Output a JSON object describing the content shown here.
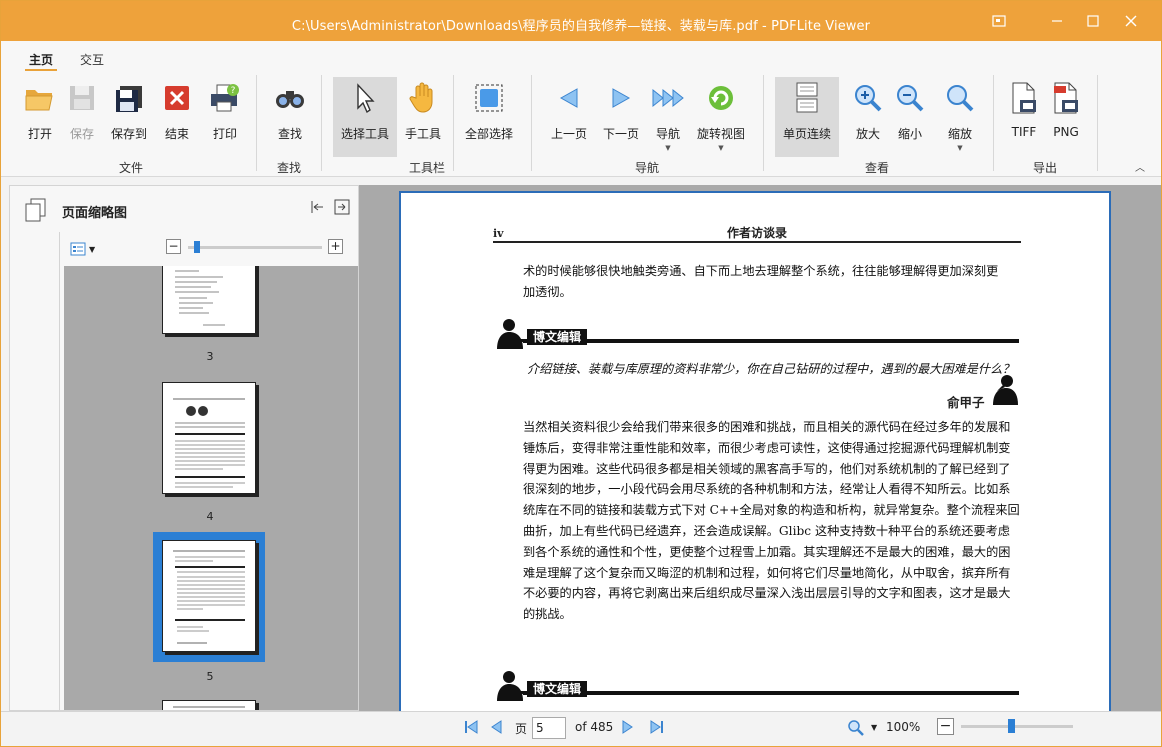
{
  "window": {
    "title": "C:\\Users\\Administrator\\Downloads\\程序员的自我修养—链接、装载与库.pdf - PDFLite Viewer"
  },
  "ribbon_tabs": [
    {
      "label": "主页",
      "active": true
    },
    {
      "label": "交互",
      "active": false
    }
  ],
  "ribbon": {
    "groups": {
      "file": "文件",
      "find": "查找",
      "toolbar": "工具栏",
      "nav": "导航",
      "view": "查看",
      "export": "导出"
    },
    "buttons": {
      "open": "打开",
      "save": "保存",
      "save_as": "保存到",
      "close": "结束",
      "print": "打印",
      "find": "查找",
      "select_tool": "选择工具",
      "hand_tool": "手工具",
      "select_all": "全部选择",
      "prev_page": "上一页",
      "next_page": "下一页",
      "navigate": "导航",
      "rotate_view": "旋转视图",
      "single_continuous": "单页连续",
      "zoom_in": "放大",
      "zoom_out": "缩小",
      "zoom": "缩放",
      "tiff": "TIFF",
      "png": "PNG"
    }
  },
  "sidepanel": {
    "title": "页面缩略图",
    "thumb_zoom": 0.05,
    "thumbnails": [
      {
        "number": "3"
      },
      {
        "number": "4"
      },
      {
        "number": "5",
        "selected": true
      }
    ]
  },
  "document_page": {
    "header_left": "iv",
    "header_center": "作者访谈录",
    "intro_lines": [
      "术的时候能够很快地触类旁通、自下而上地去理解整个系统，往往能够理解得更加深刻更",
      "加透彻。"
    ],
    "section_tag": "博文编辑",
    "question": "介绍链接、装载与库原理的资料非常少，你在自己钻研的过程中，遇到的最大困难是什么？",
    "author": "俞甲子",
    "answer_lines": [
      "当然相关资料很少会给我们带来很多的困难和挑战，而且相关的源代码在经过多年的发展和",
      "锤炼后，变得非常注重性能和效率，而很少考虑可读性，这使得通过挖掘源代码理解机制变",
      "得更为困难。这些代码很多都是相关领域的黑客高手写的，他们对系统机制的了解已经到了",
      "很深刻的地步，一小段代码会用尽系统的各种机制和方法，经常让人看得不知所云。比如系",
      "统库在不同的链接和装载方式下对 C++全局对象的构造和析构，就异常复杂。整个流程来回",
      "曲折，加上有些代码已经遗弃，还会造成误解。Glibc 这种支持数十种平台的系统还要考虑",
      "到各个系统的通性和个性，更使整个过程雪上加霜。其实理解还不是最大的困难，最大的困",
      "难是理解了这个复杂而又晦涩的机制和过程，如何将它们尽量地简化，从中取舍，摈弃所有",
      "不必要的内容，再将它剥离出来后组织成尽量深入浅出层层引导的文字和图表，这才是最大",
      "的挑战。"
    ],
    "section_tag_2": "博文编辑"
  },
  "statusbar": {
    "page_label": "页",
    "page_value": "5",
    "page_total": "of 485",
    "zoom": "100%",
    "zoom_slider": 0.45
  },
  "colors": {
    "accent": "#eea23b",
    "selection": "#2b7fd4"
  }
}
